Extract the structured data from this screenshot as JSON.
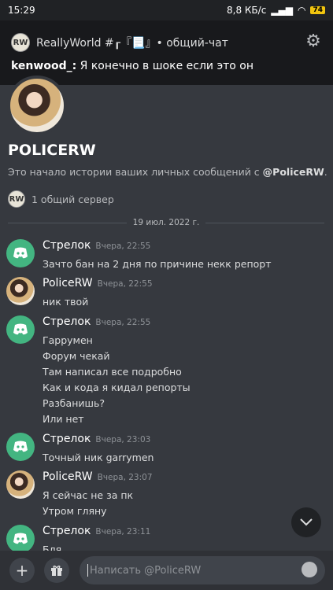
{
  "status": {
    "time": "15:29",
    "speed": "8,8 КБ/с",
    "battery": "74"
  },
  "notification": {
    "server": "ReallyWorld",
    "channel_title": "ReallyWorld #┎『📃』• общий-чат",
    "author": "kenwood_:",
    "text": "Я конечно в шоке если это он"
  },
  "profile": {
    "name": "POLICERW",
    "desc_prefix": "Это начало истории ваших личных сообщений с ",
    "desc_mention": "@PoliceRW",
    "desc_suffix": ".",
    "mutual": "1 общий сервер"
  },
  "date_divider": "19 июл. 2022 г.",
  "messages": [
    {
      "author": "Стрелок",
      "time": "Вчера, 22:55",
      "avatar": "discord",
      "lines": [
        "Зачто бан на 2 дня по причине некк репорт"
      ]
    },
    {
      "author": "PoliceRW",
      "time": "Вчера, 22:55",
      "avatar": "police",
      "lines": [
        "ник твой"
      ]
    },
    {
      "author": "Стрелок",
      "time": "Вчера, 22:55",
      "avatar": "discord",
      "lines": [
        "Гаррумен",
        "Форум чекай",
        "Там написал все подробно",
        "Как и кода я кидал репорты",
        "Разбанишь?",
        "Или нет"
      ]
    },
    {
      "author": "Стрелок",
      "time": "Вчера, 23:03",
      "avatar": "discord",
      "lines": [
        "Точный ник garrymen"
      ]
    },
    {
      "author": "PoliceRW",
      "time": "Вчера, 23:07",
      "avatar": "police",
      "lines": [
        "Я сейчас не за пк",
        "Утром гляну"
      ]
    },
    {
      "author": "Стрелок",
      "time": "Вчера, 23:11",
      "avatar": "discord",
      "lines": [
        "Бля"
      ]
    }
  ],
  "composer": {
    "placeholder": "Написать @PoliceRW"
  }
}
